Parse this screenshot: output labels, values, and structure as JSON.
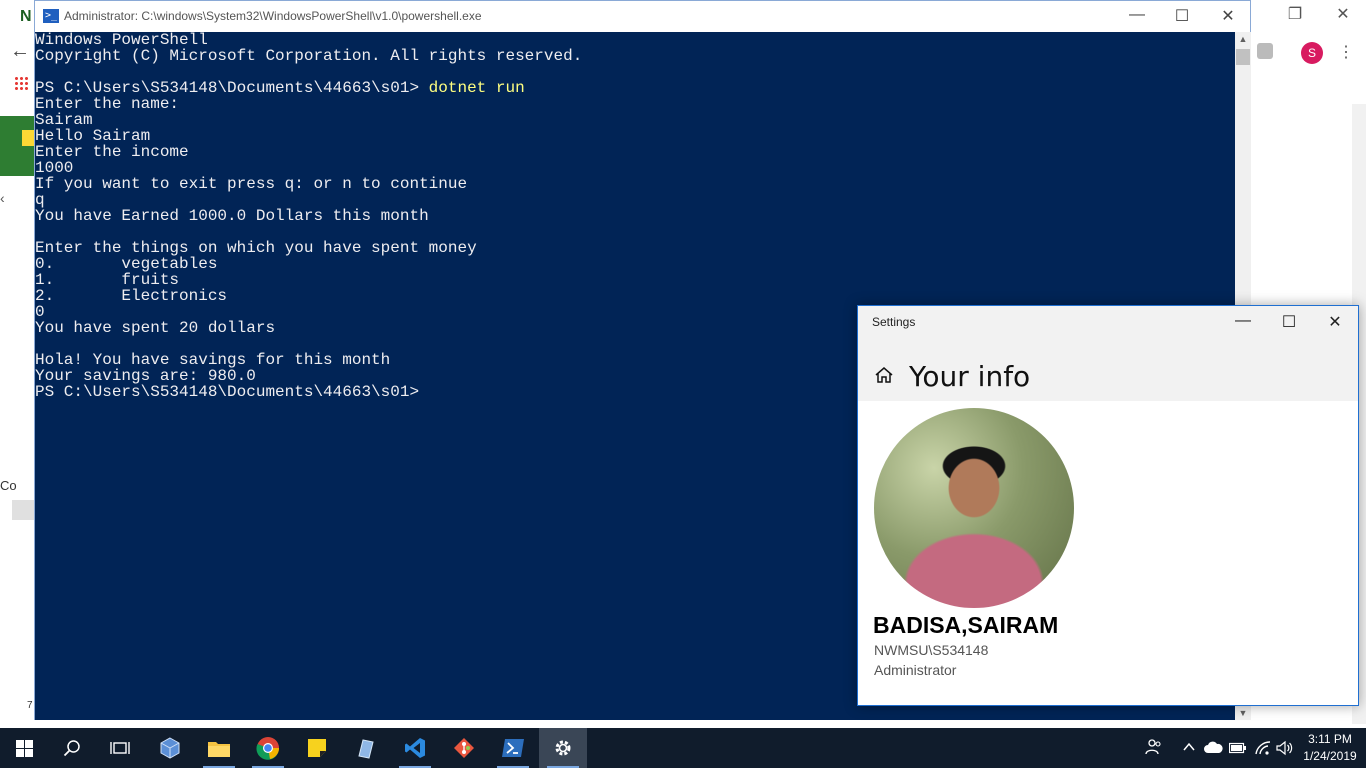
{
  "background_window": {
    "logo_letter": "N",
    "side_text": "Co",
    "side_number": "7",
    "avatar_letter": "S"
  },
  "powershell": {
    "title": "Administrator: C:\\windows\\System32\\WindowsPowerShell\\v1.0\\powershell.exe",
    "lines": [
      {
        "text": "Windows PowerShell"
      },
      {
        "text": "Copyright (C) Microsoft Corporation. All rights reserved."
      },
      {
        "text": ""
      },
      {
        "prompt": "PS C:\\Users\\S534148\\Documents\\44663\\s01> ",
        "cmd": "dotnet run"
      },
      {
        "text": "Enter the name:"
      },
      {
        "text": "Sairam"
      },
      {
        "text": "Hello Sairam"
      },
      {
        "text": "Enter the income"
      },
      {
        "text": "1000"
      },
      {
        "text": "If you want to exit press q: or n to continue"
      },
      {
        "text": "q"
      },
      {
        "text": "You have Earned 1000.0 Dollars this month"
      },
      {
        "text": ""
      },
      {
        "text": "Enter the things on which you have spent money"
      },
      {
        "text": "0.       vegetables"
      },
      {
        "text": "1.       fruits"
      },
      {
        "text": "2.       Electronics"
      },
      {
        "text": "0"
      },
      {
        "text": "You have spent 20 dollars"
      },
      {
        "text": ""
      },
      {
        "text": "Hola! You have savings for this month"
      },
      {
        "text": "Your savings are: 980.0"
      },
      {
        "text": "PS C:\\Users\\S534148\\Documents\\44663\\s01>"
      }
    ]
  },
  "settings": {
    "title": "Settings",
    "heading": "Your info",
    "user_name": "BADISA,SAIRAM",
    "account": "NWMSU\\S534148",
    "role": "Administrator"
  },
  "taskbar": {
    "icons": [
      "windows-start-icon",
      "search-icon",
      "task-view-icon",
      "virtualbox-icon",
      "file-explorer-icon",
      "chrome-icon",
      "sticky-notes-icon",
      "pen-app-icon",
      "vscode-icon",
      "git-icon",
      "powershell-icon",
      "settings-gear-icon"
    ],
    "time": "3:11 PM",
    "date": "1/24/2019"
  }
}
